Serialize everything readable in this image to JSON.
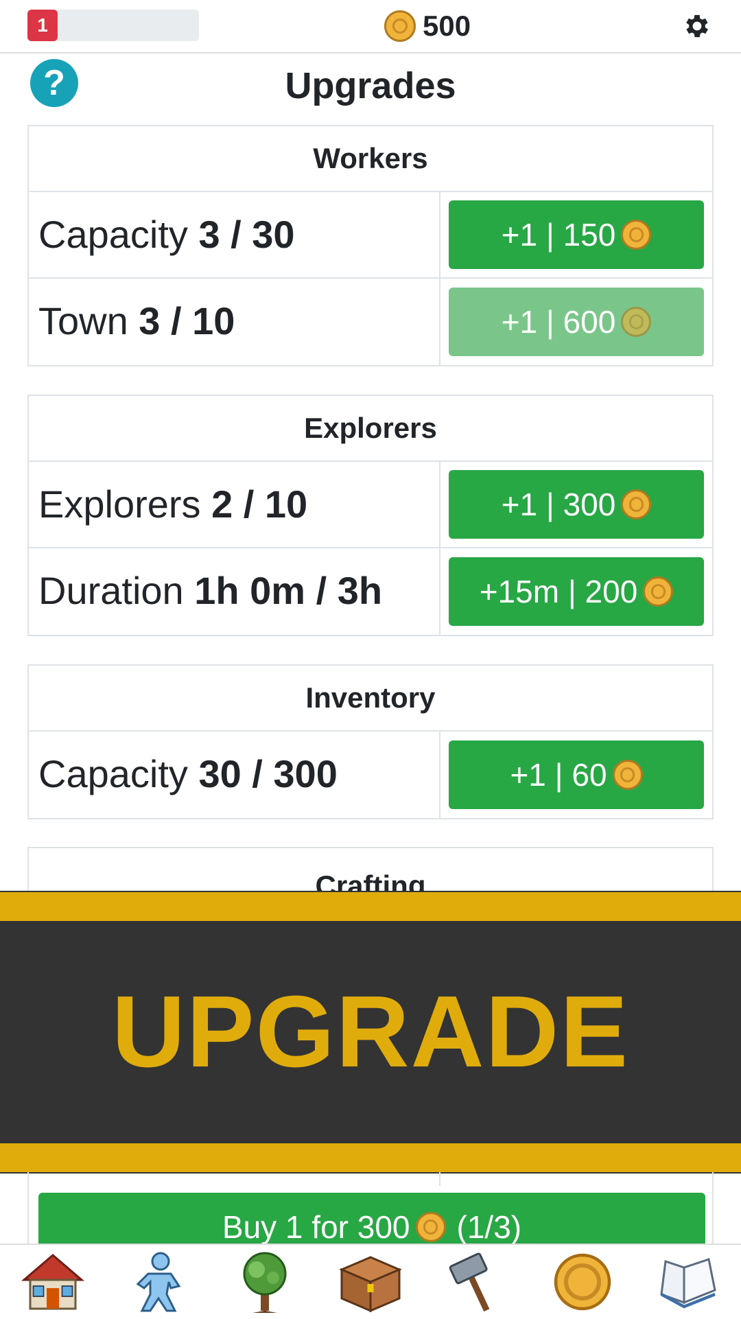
{
  "header": {
    "level": "1",
    "xp_progress_percent": 0,
    "coins": "500"
  },
  "page": {
    "title": "Upgrades"
  },
  "sections": {
    "workers": {
      "title": "Workers",
      "rows": [
        {
          "label": "Capacity",
          "value": "3 / 30",
          "button": "+1 | 150",
          "enabled": true
        },
        {
          "label": "Town",
          "value": "3 / 10",
          "button": "+1 | 600",
          "enabled": false
        }
      ]
    },
    "explorers": {
      "title": "Explorers",
      "rows": [
        {
          "label": "Explorers",
          "value": "2 / 10",
          "button": "+1 | 300",
          "enabled": true
        },
        {
          "label": "Duration",
          "value": "1h 0m / 3h",
          "button": "+15m | 200",
          "enabled": true
        }
      ]
    },
    "inventory": {
      "title": "Inventory",
      "rows": [
        {
          "label": "Capacity",
          "value": "30 / 300",
          "button": "+1 | 60",
          "enabled": true
        }
      ]
    },
    "crafting": {
      "title": "Crafting"
    }
  },
  "banner": {
    "text": "UPGRADE"
  },
  "buy_button": {
    "label": "Buy 1 for 300",
    "count": "(1/3)"
  },
  "nav": {
    "items": [
      "house-icon",
      "explorer-icon",
      "tree-icon",
      "chest-icon",
      "hammer-icon",
      "coin-icon",
      "book-icon"
    ]
  },
  "colors": {
    "green": "#28a745",
    "green_disabled": "#7ac68a",
    "badge_red": "#dc3545",
    "help_teal": "#17a2b8",
    "banner_gold": "#e0ac0c",
    "banner_dark": "#333333"
  }
}
